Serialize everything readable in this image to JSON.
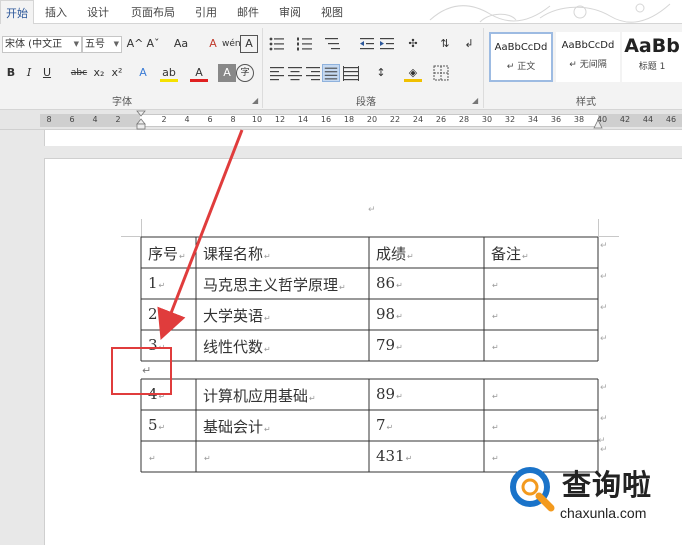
{
  "tabs": [
    "开始",
    "插入",
    "设计",
    "页面布局",
    "引用",
    "邮件",
    "审阅",
    "视图"
  ],
  "font_group": {
    "font_name": "宋体 (中文正\u0010",
    "font_size": "五号",
    "label": "字体",
    "grow_font": "A^",
    "shrink_font": "Aˇ",
    "change_case": "Aa",
    "clear_format": "A",
    "phonetic": "wén",
    "char_border": "A",
    "bold": "B",
    "italic": "I",
    "underline": "U",
    "strikethrough": "abc",
    "subscript": "x₂",
    "superscript": "x²",
    "text_effect": "A",
    "highlight": "ab",
    "font_color": "A",
    "char_shading": "A",
    "enclose": "字"
  },
  "paragraph_group": {
    "label": "段落"
  },
  "styles_group": {
    "label": "样式",
    "items": [
      {
        "sample": "AaBbCcDd",
        "name": "↵ 正文"
      },
      {
        "sample": "AaBbCcDd",
        "name": "↵ 无间隔"
      },
      {
        "sample": "AaBb",
        "name": "标题 1"
      }
    ]
  },
  "ruler": {
    "ticks": [
      "8",
      "6",
      "4",
      "2",
      "2",
      "4",
      "6",
      "8",
      "10",
      "12",
      "14",
      "16",
      "18",
      "20",
      "22",
      "24",
      "26",
      "28",
      "30",
      "32",
      "34",
      "36",
      "38",
      "40",
      "42",
      "44",
      "46"
    ]
  },
  "table": {
    "header": [
      "序号",
      "课程名称",
      "成绩",
      "备注"
    ],
    "rows_top": [
      [
        "1",
        "马克思主义哲学原理",
        "86",
        ""
      ],
      [
        "2",
        "大学英语",
        "98",
        ""
      ],
      [
        "3",
        "线性代数",
        "79",
        ""
      ]
    ],
    "rows_bottom": [
      [
        "4",
        "计算机应用基础",
        "89",
        ""
      ],
      [
        "5",
        "基础会计",
        "7",
        ""
      ],
      [
        "",
        "",
        "431",
        ""
      ]
    ]
  },
  "marks": {
    "cell": "↵",
    "para": "↵"
  },
  "watermark": {
    "name": "查询啦",
    "url": "chaxunla.com"
  },
  "colors": {
    "accent": "#2b579a",
    "annotation": "#e03c3c",
    "watermark_blue": "#1a73c9",
    "watermark_orange": "#f39a1e"
  }
}
